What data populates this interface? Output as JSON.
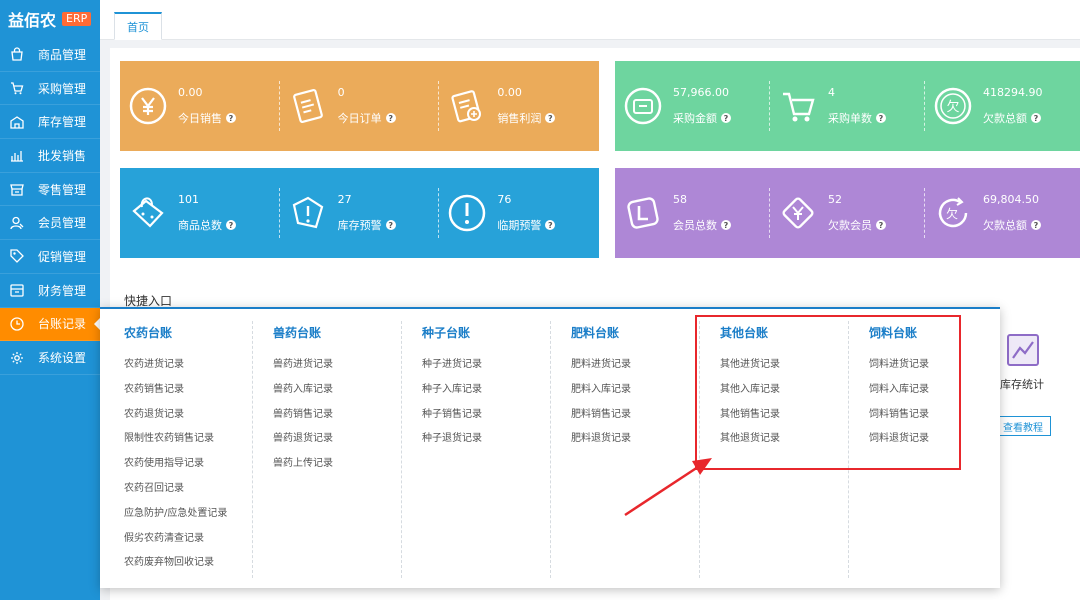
{
  "app": {
    "name": "益佰农",
    "badge": "ERP"
  },
  "sidebar": {
    "items": [
      {
        "label": "商品管理",
        "icon": "bag-icon"
      },
      {
        "label": "采购管理",
        "icon": "cart-icon"
      },
      {
        "label": "库存管理",
        "icon": "warehouse-icon"
      },
      {
        "label": "批发销售",
        "icon": "bar-chart-icon"
      },
      {
        "label": "零售管理",
        "icon": "store-icon"
      },
      {
        "label": "会员管理",
        "icon": "user-icon"
      },
      {
        "label": "促销管理",
        "icon": "tag-icon"
      },
      {
        "label": "财务管理",
        "icon": "finance-icon"
      },
      {
        "label": "台账记录",
        "icon": "clock-icon",
        "active": true
      },
      {
        "label": "系统设置",
        "icon": "gear-icon"
      }
    ]
  },
  "tabs": {
    "home": "首页"
  },
  "stats": {
    "today_sales": {
      "value": "0.00",
      "label": "今日销售"
    },
    "today_orders": {
      "value": "0",
      "label": "今日订单"
    },
    "sales_profit": {
      "value": "0.00",
      "label": "销售利润"
    },
    "purchase_amount": {
      "value": "57,966.00",
      "label": "采购金额"
    },
    "purchase_count": {
      "value": "4",
      "label": "采购单数"
    },
    "debt_total_1": {
      "value": "418294.90",
      "label": "欠款总额"
    },
    "product_total": {
      "value": "101",
      "label": "商品总数"
    },
    "stock_warning": {
      "value": "27",
      "label": "库存预警"
    },
    "expiry_warning": {
      "value": "76",
      "label": "临期预警"
    },
    "member_total": {
      "value": "58",
      "label": "会员总数"
    },
    "debt_members": {
      "value": "52",
      "label": "欠款会员"
    },
    "debt_total_2": {
      "value": "69,804.50",
      "label": "欠款总额"
    }
  },
  "colors": {
    "orange": "#ebab5a",
    "green": "#6ed59f",
    "blue": "#27a2d9",
    "purple": "#ae87d6",
    "accent": "#1f93d6",
    "highlight": "#e8272c"
  },
  "quick": {
    "title": "快捷入口",
    "stock_stats": "库存统计",
    "tutorial": "查看教程"
  },
  "ledger": {
    "columns": [
      {
        "title": "农药台账",
        "items": [
          "农药进货记录",
          "农药销售记录",
          "农药退货记录",
          "限制性农药销售记录",
          "农药使用指导记录",
          "农药召回记录",
          "应急防护/应急处置记录",
          "假劣农药清查记录",
          "农药废弃物回收记录"
        ]
      },
      {
        "title": "兽药台账",
        "items": [
          "兽药进货记录",
          "兽药入库记录",
          "兽药销售记录",
          "兽药退货记录",
          "兽药上传记录"
        ]
      },
      {
        "title": "种子台账",
        "items": [
          "种子进货记录",
          "种子入库记录",
          "种子销售记录",
          "种子退货记录"
        ]
      },
      {
        "title": "肥料台账",
        "items": [
          "肥料进货记录",
          "肥料入库记录",
          "肥料销售记录",
          "肥料退货记录"
        ]
      },
      {
        "title": "其他台账",
        "items": [
          "其他进货记录",
          "其他入库记录",
          "其他销售记录",
          "其他退货记录"
        ]
      },
      {
        "title": "饲料台账",
        "items": [
          "饲料进货记录",
          "饲料入库记录",
          "饲料销售记录",
          "饲料退货记录"
        ]
      }
    ]
  }
}
